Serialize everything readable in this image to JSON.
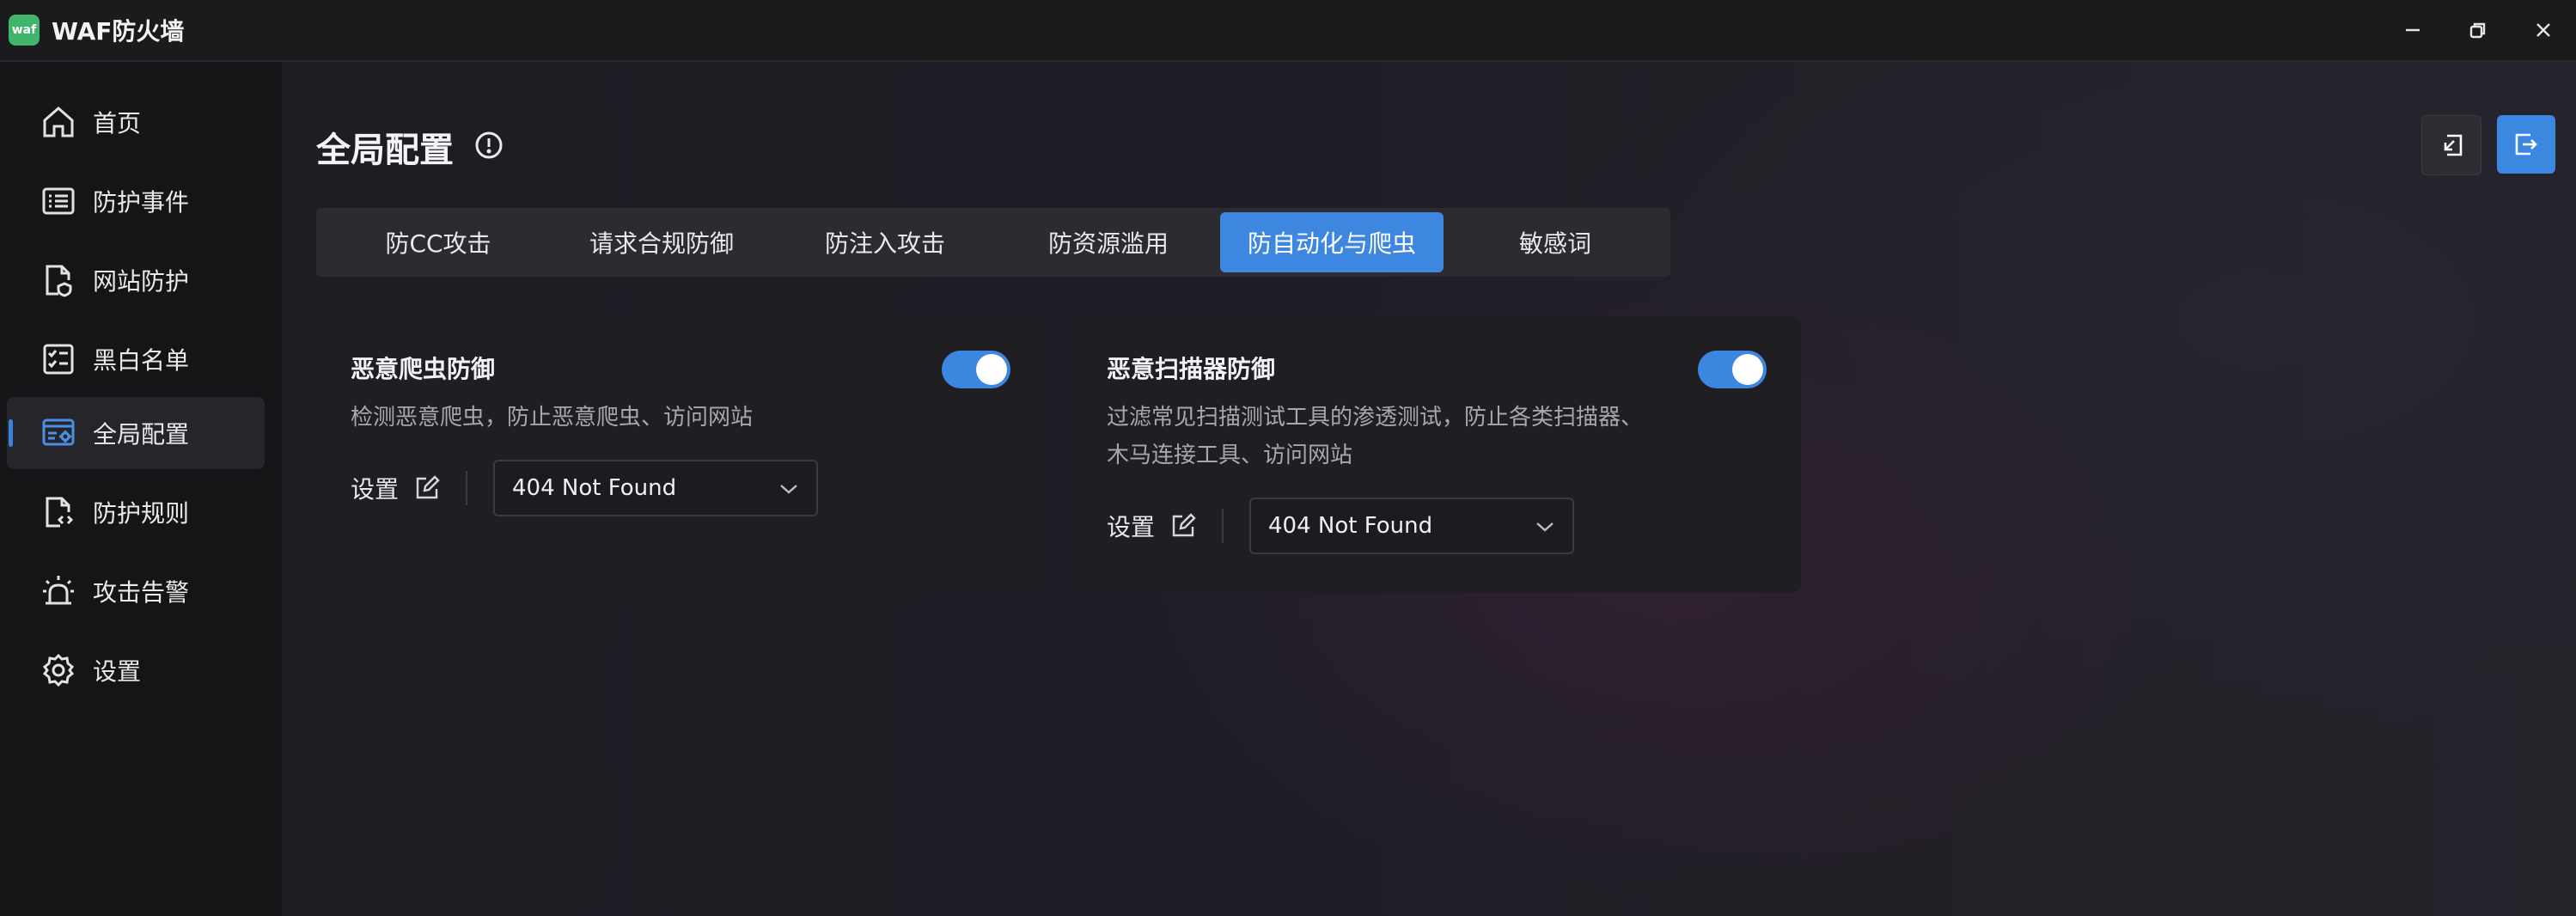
{
  "app": {
    "title": "WAF防火墙",
    "logo_text": "waf"
  },
  "sidebar": {
    "items": [
      {
        "label": "首页",
        "icon": "home-icon"
      },
      {
        "label": "防护事件",
        "icon": "list-icon"
      },
      {
        "label": "网站防护",
        "icon": "file-shield-icon"
      },
      {
        "label": "黑白名单",
        "icon": "checklist-icon"
      },
      {
        "label": "全局配置",
        "icon": "browser-gear-icon",
        "active": true
      },
      {
        "label": "防护规则",
        "icon": "file-code-icon"
      },
      {
        "label": "攻击告警",
        "icon": "alarm-icon"
      },
      {
        "label": "设置",
        "icon": "gear-icon"
      }
    ]
  },
  "page": {
    "title": "全局配置"
  },
  "tabs": [
    {
      "label": "防CC攻击"
    },
    {
      "label": "请求合规防御"
    },
    {
      "label": "防注入攻击"
    },
    {
      "label": "防资源滥用"
    },
    {
      "label": "防自动化与爬虫",
      "active": true
    },
    {
      "label": "敏感词"
    }
  ],
  "cards": [
    {
      "title": "恶意爬虫防御",
      "description": "检测恶意爬虫，防止恶意爬虫、访问网站",
      "enabled": true,
      "settings_label": "设置",
      "select_value": "404 Not Found"
    },
    {
      "title": "恶意扫描器防御",
      "description": "过滤常见扫描测试工具的渗透测试，防止各类扫描器、木马连接工具、访问网站",
      "enabled": true,
      "settings_label": "设置",
      "select_value": "404 Not Found"
    }
  ],
  "colors": {
    "accent": "#3d87e0",
    "logo": "#3fb56b"
  }
}
